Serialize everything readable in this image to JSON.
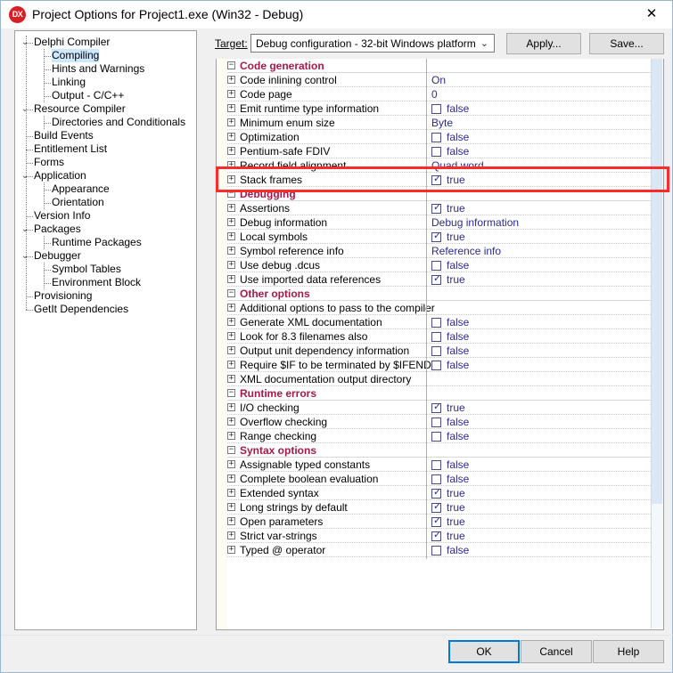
{
  "window": {
    "title": "Project Options for Project1.exe  (Win32 - Debug)",
    "icon_label": "DX",
    "close_icon": "✕"
  },
  "target": {
    "label": "Target:",
    "value": "Debug configuration - 32-bit Windows platform",
    "chevron": "⌄",
    "apply_label": "Apply...",
    "save_label": "Save..."
  },
  "tree": {
    "items": [
      {
        "label": "Delphi Compiler",
        "depth": 0,
        "expander": "⌄",
        "selected": false
      },
      {
        "label": "Compiling",
        "depth": 1,
        "expander": "",
        "selected": true
      },
      {
        "label": "Hints and Warnings",
        "depth": 1,
        "expander": "",
        "selected": false
      },
      {
        "label": "Linking",
        "depth": 1,
        "expander": "",
        "selected": false
      },
      {
        "label": "Output - C/C++",
        "depth": 1,
        "expander": "",
        "selected": false
      },
      {
        "label": "Resource Compiler",
        "depth": 0,
        "expander": "⌄",
        "selected": false
      },
      {
        "label": "Directories and Conditionals",
        "depth": 1,
        "expander": "",
        "selected": false
      },
      {
        "label": "Build Events",
        "depth": 0,
        "expander": "",
        "selected": false
      },
      {
        "label": "Entitlement List",
        "depth": 0,
        "expander": "",
        "selected": false
      },
      {
        "label": "Forms",
        "depth": 0,
        "expander": "",
        "selected": false
      },
      {
        "label": "Application",
        "depth": 0,
        "expander": "⌄",
        "selected": false
      },
      {
        "label": "Appearance",
        "depth": 1,
        "expander": "",
        "selected": false
      },
      {
        "label": "Orientation",
        "depth": 1,
        "expander": "",
        "selected": false
      },
      {
        "label": "Version Info",
        "depth": 0,
        "expander": "",
        "selected": false
      },
      {
        "label": "Packages",
        "depth": 0,
        "expander": "⌄",
        "selected": false
      },
      {
        "label": "Runtime Packages",
        "depth": 1,
        "expander": "",
        "selected": false
      },
      {
        "label": "Debugger",
        "depth": 0,
        "expander": "⌄",
        "selected": false
      },
      {
        "label": "Symbol Tables",
        "depth": 1,
        "expander": "",
        "selected": false
      },
      {
        "label": "Environment Block",
        "depth": 1,
        "expander": "",
        "selected": false
      },
      {
        "label": "Provisioning",
        "depth": 0,
        "expander": "",
        "selected": false
      },
      {
        "label": "GetIt Dependencies",
        "depth": 0,
        "expander": "",
        "selected": false
      }
    ]
  },
  "grid": {
    "rows": [
      {
        "kind": "category",
        "name": "Code generation",
        "expander": "−"
      },
      {
        "kind": "prop",
        "name": "Code inlining control",
        "expander": "+",
        "value": "On"
      },
      {
        "kind": "prop",
        "name": "Code page",
        "expander": "+",
        "value": "0"
      },
      {
        "kind": "prop",
        "name": "Emit runtime type information",
        "expander": "+",
        "check": false,
        "value": "false"
      },
      {
        "kind": "prop",
        "name": "Minimum enum size",
        "expander": "+",
        "value": "Byte"
      },
      {
        "kind": "prop",
        "name": "Optimization",
        "expander": "+",
        "check": false,
        "value": "false"
      },
      {
        "kind": "prop",
        "name": "Pentium-safe FDIV",
        "expander": "+",
        "check": false,
        "value": "false"
      },
      {
        "kind": "prop",
        "name": "Record field alignment",
        "expander": "+",
        "value": "Quad word"
      },
      {
        "kind": "prop",
        "name": "Stack frames",
        "expander": "+",
        "check": true,
        "value": "true"
      },
      {
        "kind": "category",
        "name": "Debugging",
        "expander": "−"
      },
      {
        "kind": "prop",
        "name": "Assertions",
        "expander": "+",
        "check": true,
        "value": "true"
      },
      {
        "kind": "prop",
        "name": "Debug information",
        "expander": "+",
        "value": "Debug information"
      },
      {
        "kind": "prop",
        "name": "Local symbols",
        "expander": "+",
        "check": true,
        "value": "true"
      },
      {
        "kind": "prop",
        "name": "Symbol reference info",
        "expander": "+",
        "value": "Reference info"
      },
      {
        "kind": "prop",
        "name": "Use debug .dcus",
        "expander": "+",
        "check": false,
        "value": "false"
      },
      {
        "kind": "prop",
        "name": "Use imported data references",
        "expander": "+",
        "check": true,
        "value": "true"
      },
      {
        "kind": "category",
        "name": "Other options",
        "expander": "−"
      },
      {
        "kind": "prop",
        "name": "Additional options to pass to the compiler",
        "expander": "+",
        "value": ""
      },
      {
        "kind": "prop",
        "name": "Generate XML documentation",
        "expander": "+",
        "check": false,
        "value": "false"
      },
      {
        "kind": "prop",
        "name": "Look for 8.3 filenames also",
        "expander": "+",
        "check": false,
        "value": "false"
      },
      {
        "kind": "prop",
        "name": "Output unit dependency information",
        "expander": "+",
        "check": false,
        "value": "false"
      },
      {
        "kind": "prop",
        "name": "Require $IF to be terminated by $IFEND",
        "expander": "+",
        "check": false,
        "value": "false"
      },
      {
        "kind": "prop",
        "name": "XML documentation output directory",
        "expander": "+",
        "value": ""
      },
      {
        "kind": "category",
        "name": "Runtime errors",
        "expander": "−"
      },
      {
        "kind": "prop",
        "name": "I/O checking",
        "expander": "+",
        "check": true,
        "value": "true"
      },
      {
        "kind": "prop",
        "name": "Overflow checking",
        "expander": "+",
        "check": false,
        "value": "false"
      },
      {
        "kind": "prop",
        "name": "Range checking",
        "expander": "+",
        "check": false,
        "value": "false"
      },
      {
        "kind": "category",
        "name": "Syntax options",
        "expander": "−"
      },
      {
        "kind": "prop",
        "name": "Assignable typed constants",
        "expander": "+",
        "check": false,
        "value": "false"
      },
      {
        "kind": "prop",
        "name": "Complete boolean evaluation",
        "expander": "+",
        "check": false,
        "value": "false"
      },
      {
        "kind": "prop",
        "name": "Extended syntax",
        "expander": "+",
        "check": true,
        "value": "true"
      },
      {
        "kind": "prop",
        "name": "Long strings by default",
        "expander": "+",
        "check": true,
        "value": "true"
      },
      {
        "kind": "prop",
        "name": "Open parameters",
        "expander": "+",
        "check": true,
        "value": "true"
      },
      {
        "kind": "prop",
        "name": "Strict var-strings",
        "expander": "+",
        "check": true,
        "value": "true"
      },
      {
        "kind": "prop",
        "name": "Typed @ operator",
        "expander": "+",
        "check": false,
        "value": "false"
      }
    ]
  },
  "annotation": {
    "highlight_color": "#ff2a2a",
    "highlight_target": "Stack frames"
  },
  "footer": {
    "ok_label": "OK",
    "cancel_label": "Cancel",
    "help_label": "Help"
  },
  "colors": {
    "category_text": "#a41b4a",
    "value_text": "#2b2b8f",
    "selection": "#cde8ff",
    "accent": "#0078d7"
  }
}
